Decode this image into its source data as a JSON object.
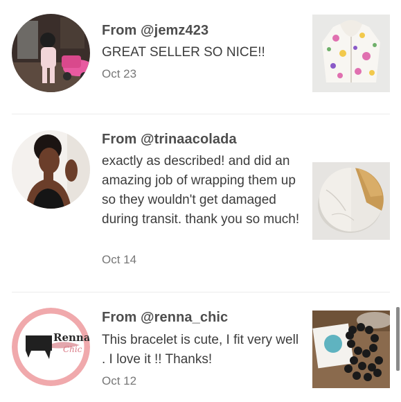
{
  "reviews": [
    {
      "from": "From @jemz423",
      "text": "GREAT SELLER SO NICE!!",
      "date": "Oct 23",
      "avatar_icon": "photo-child-with-toy-car",
      "thumb_icon": "photo-floral-hoodie"
    },
    {
      "from": "From @trinaacolada",
      "text": "exactly as described! and did an amazing job of wrapping them up so they wouldn't get damaged during transit. thank you so much!",
      "date": "Oct 14",
      "avatar_icon": "photo-woman-portrait",
      "thumb_icon": "photo-marble-gold-coasters"
    },
    {
      "from": "From @renna_chic",
      "text": "This bracelet is cute, I fit very well . I love it !! Thanks!",
      "date": "Oct 12",
      "avatar_icon": "logo-renna-chic",
      "avatar_logo_text_1": "Renna",
      "avatar_logo_text_2": "Chic",
      "thumb_icon": "photo-black-bead-bracelet"
    }
  ],
  "colors": {
    "username": "#4d4d4d",
    "text": "#3c3c3c",
    "date": "#777777",
    "divider": "#ececec",
    "scrollbar": "#8a8a8a"
  }
}
